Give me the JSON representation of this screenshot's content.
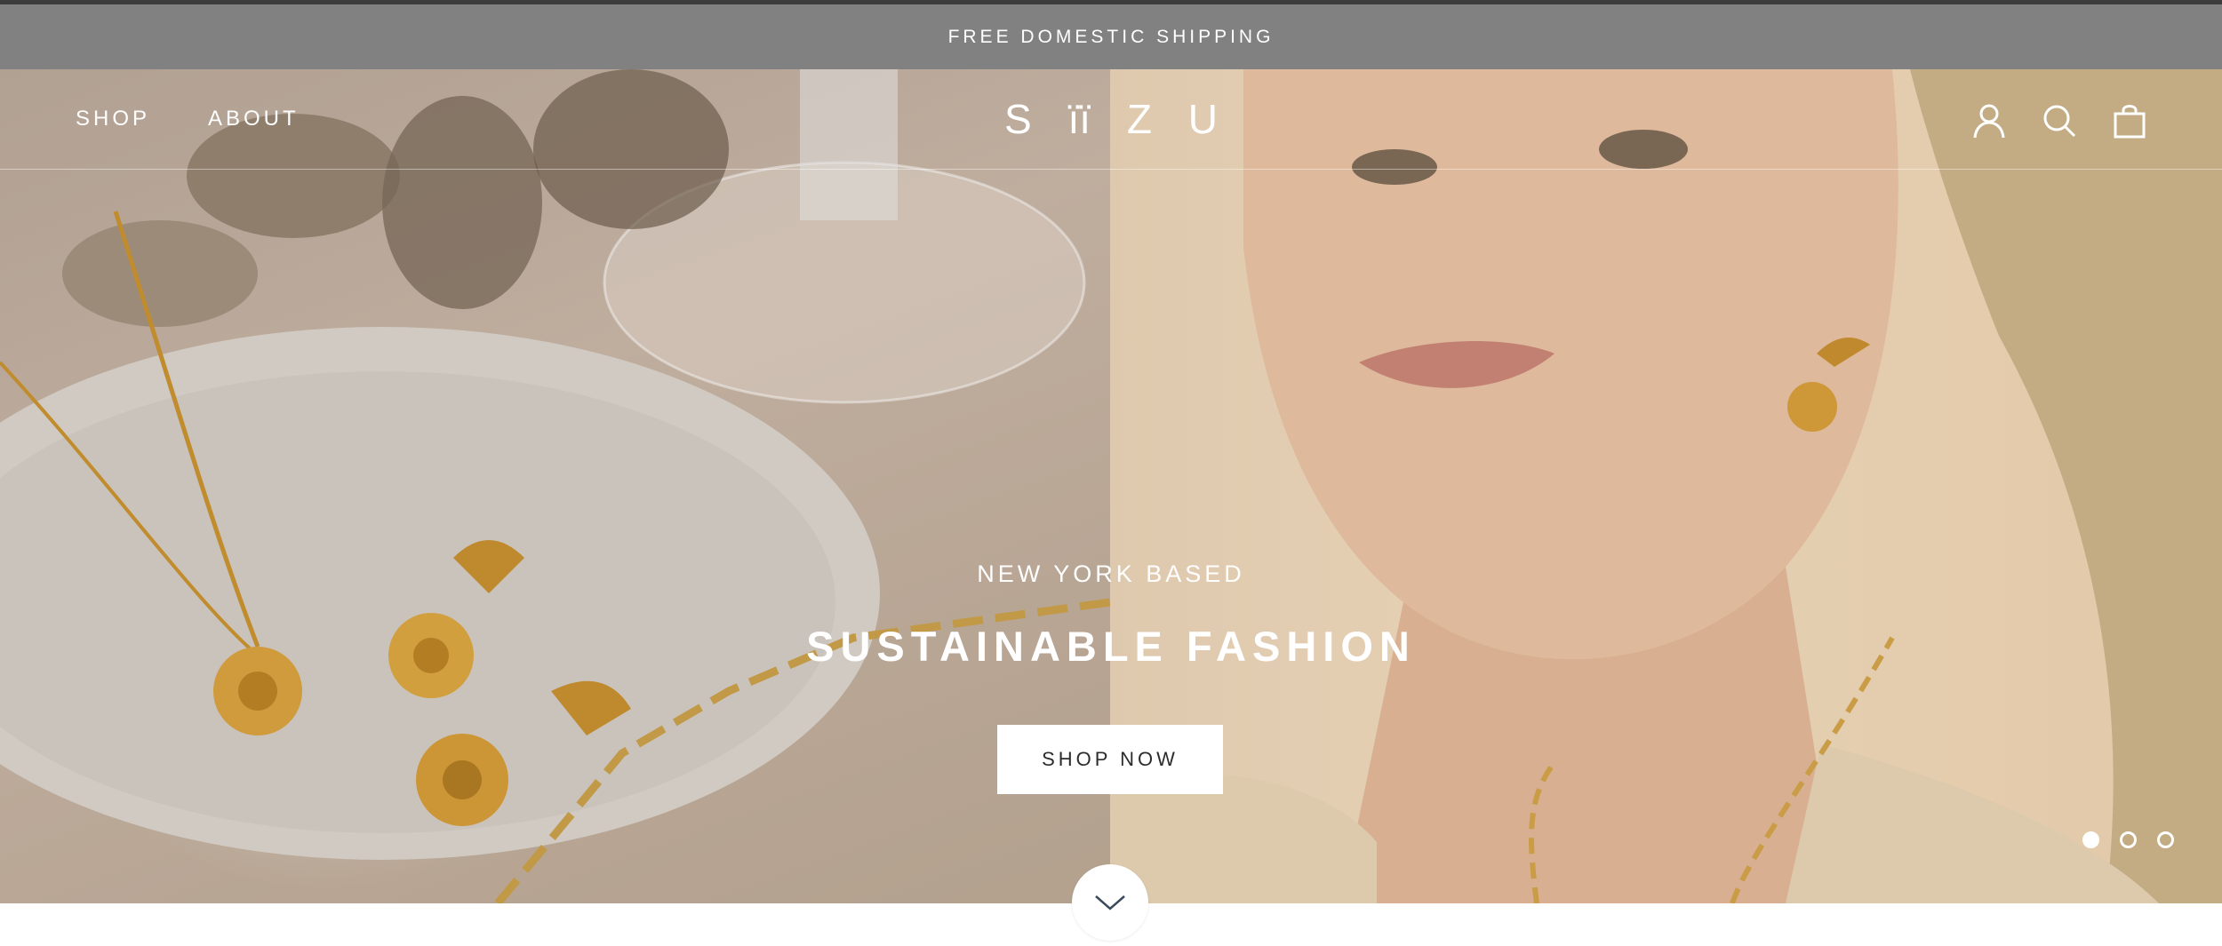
{
  "announcement": {
    "text": "FREE DOMESTIC SHIPPING"
  },
  "header": {
    "nav": [
      {
        "label": "SHOP"
      },
      {
        "label": "ABOUT"
      }
    ],
    "logo": {
      "text": "SIIZU",
      "letters": [
        "S",
        "ïï",
        "Z",
        "U"
      ]
    },
    "icons": [
      "account-icon",
      "search-icon",
      "cart-icon"
    ]
  },
  "hero": {
    "kicker": "NEW YORK BASED",
    "headline": "SUSTAINABLE FASHION",
    "cta_label": "SHOP NOW",
    "slides_total": 3,
    "active_slide": 1
  },
  "colors": {
    "announcement_bg": "#818181",
    "hero_left": "#c2b0a0",
    "hero_right": "#ecd6b9",
    "text": "#ffffff",
    "button_text": "#2c2c2c"
  }
}
